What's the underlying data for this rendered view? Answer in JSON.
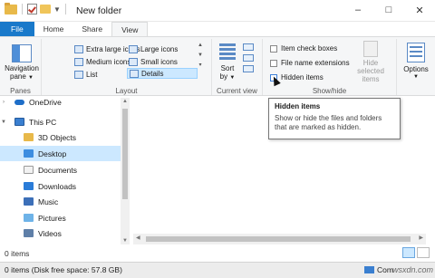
{
  "title": "New folder",
  "window_controls": {
    "minimize": "–",
    "maximize": "□",
    "close": "✕"
  },
  "tabs": [
    {
      "label": "File"
    },
    {
      "label": "Home"
    },
    {
      "label": "Share"
    },
    {
      "label": "View"
    }
  ],
  "ribbon": {
    "panes": {
      "label_line1": "Navigation",
      "label_line2": "pane",
      "group": "Panes"
    },
    "layout": {
      "group": "Layout",
      "items": [
        "Extra large icons",
        "Large icons",
        "Medium icons",
        "Small icons",
        "List",
        "Details"
      ],
      "selected": "Details"
    },
    "current_view": {
      "sort_line1": "Sort",
      "sort_line2": "by",
      "group": "Current view"
    },
    "show_hide": {
      "group": "Show/hide",
      "item_check_boxes": "Item check boxes",
      "file_name_extensions": "File name extensions",
      "hidden_items": "Hidden items",
      "hide_selected_line1": "Hide selected",
      "hide_selected_line2": "items"
    },
    "options": {
      "label": "Options"
    }
  },
  "nav": {
    "items": [
      {
        "label": "OneDrive",
        "icon": "onedrive-icon"
      },
      {
        "label": "This PC",
        "icon": "pc-icon"
      },
      {
        "label": "3D Objects",
        "icon": "folder-icon"
      },
      {
        "label": "Desktop",
        "icon": "desktop-icon"
      },
      {
        "label": "Documents",
        "icon": "documents-icon"
      },
      {
        "label": "Downloads",
        "icon": "downloads-icon"
      },
      {
        "label": "Music",
        "icon": "music-icon"
      },
      {
        "label": "Pictures",
        "icon": "pictures-icon"
      },
      {
        "label": "Videos",
        "icon": "videos-icon"
      }
    ],
    "selected": "Desktop"
  },
  "tooltip": {
    "title": "Hidden items",
    "body": "Show or hide the files and folders that are marked as hidden."
  },
  "status": {
    "count": "0 items"
  },
  "taskbar": {
    "text": "0 items (Disk free space: 57.8 GB)",
    "right": "Com"
  },
  "watermark": "wsxdn.com",
  "colors": {
    "file_tab": "#1979ca",
    "selection": "#cce8ff",
    "folder": "#e8b94a"
  }
}
